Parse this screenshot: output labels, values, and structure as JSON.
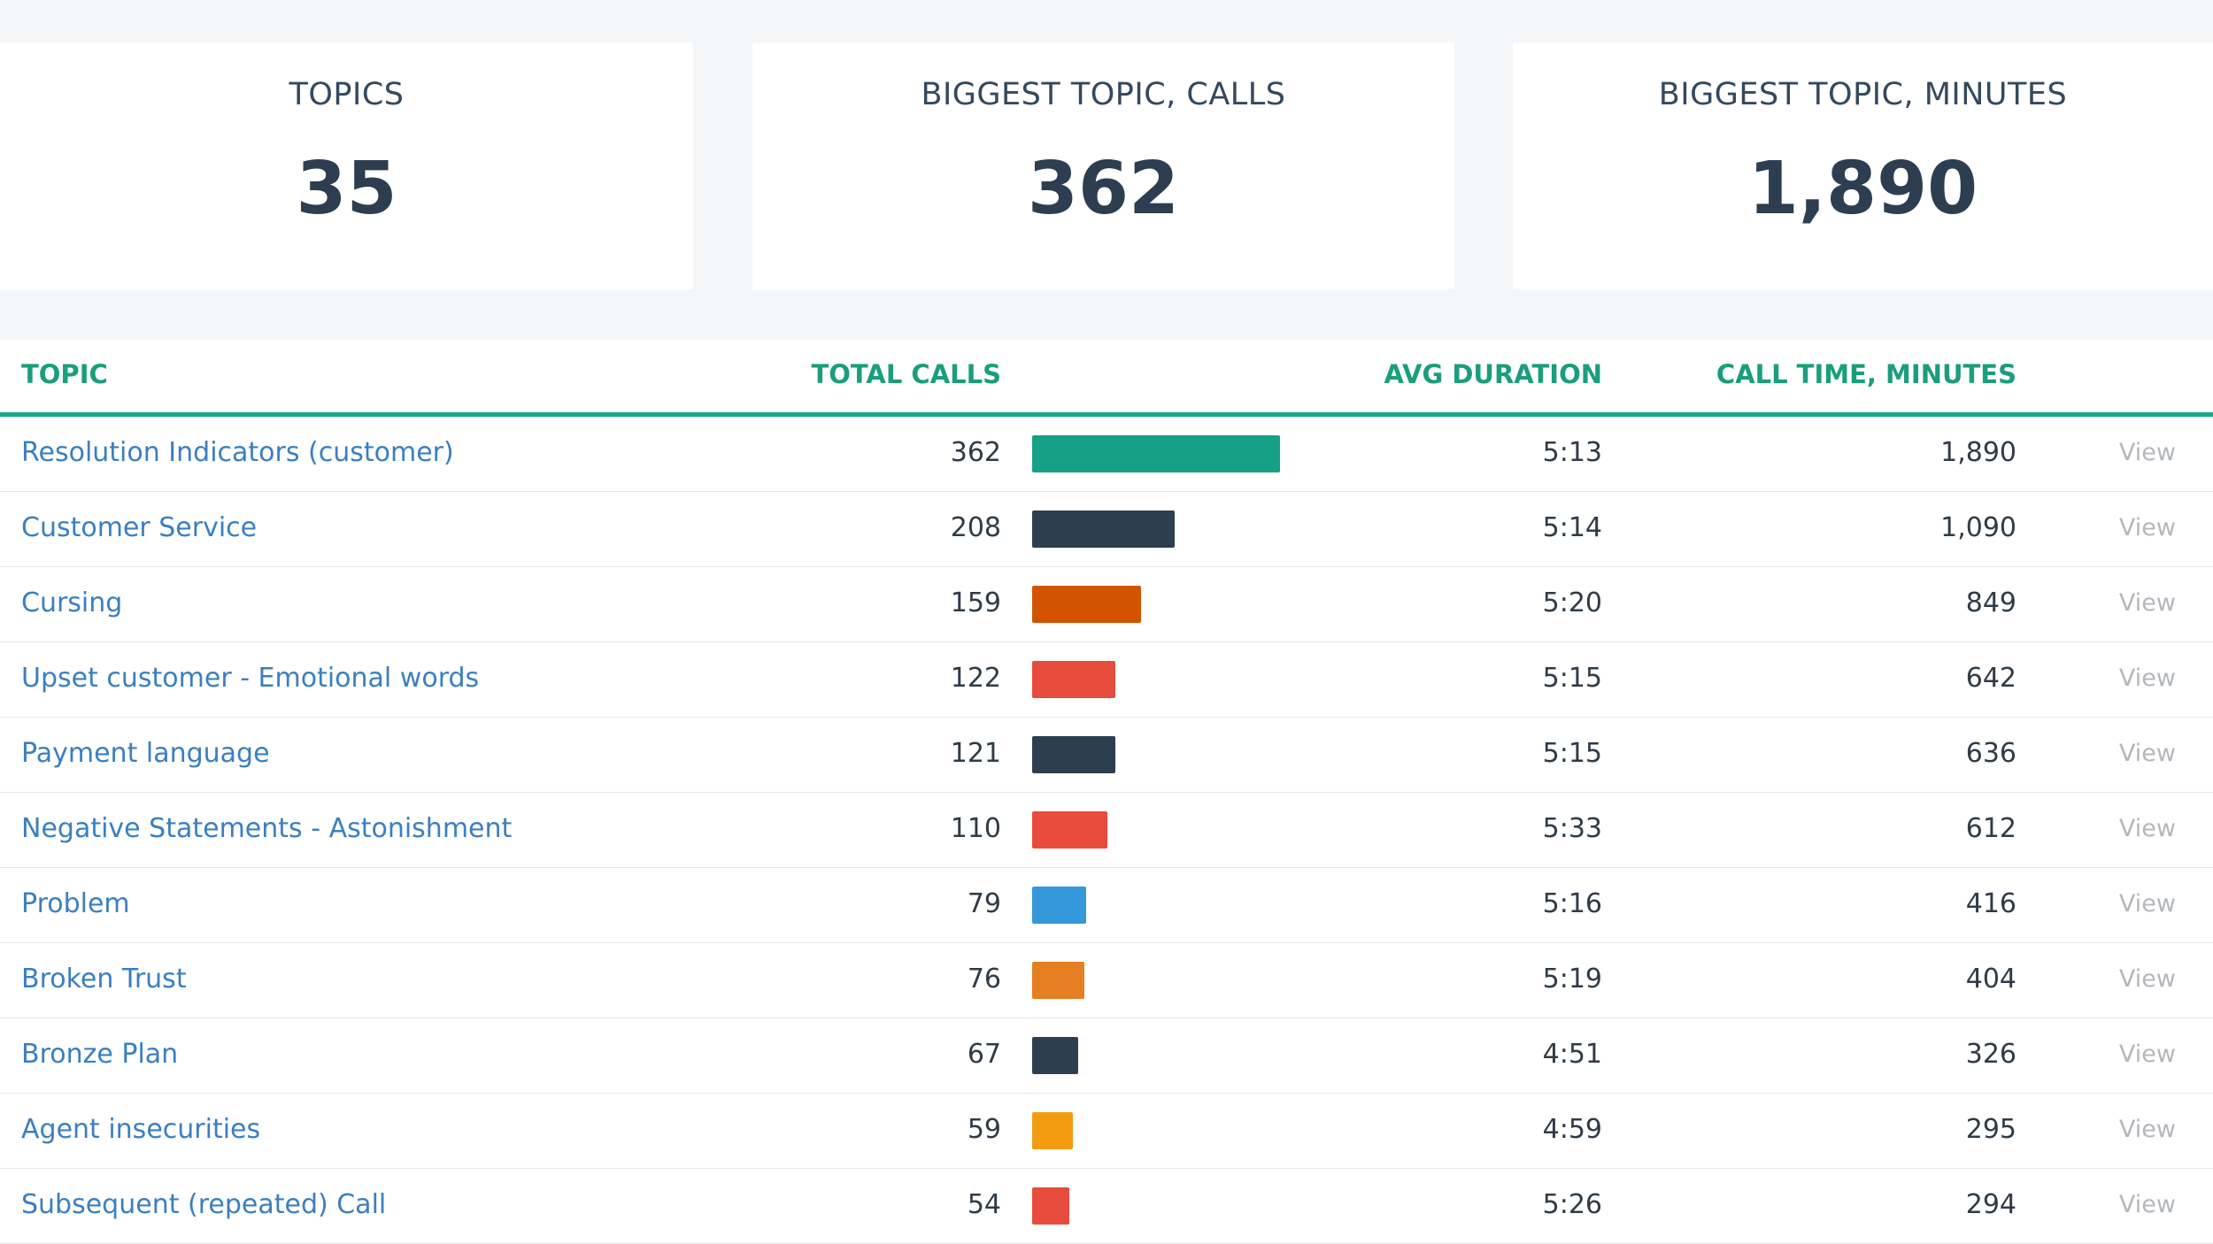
{
  "summary": {
    "topics_label": "TOPICS",
    "topics_value": "35",
    "biggest_calls_label": "BIGGEST TOPIC, CALLS",
    "biggest_calls_value": "362",
    "biggest_minutes_label": "BIGGEST TOPIC, MINUTES",
    "biggest_minutes_value": "1,890"
  },
  "table": {
    "headers": {
      "topic": "TOPIC",
      "total_calls": "TOTAL CALLS",
      "avg_duration": "AVG DURATION",
      "call_time": "CALL TIME, MINUTES"
    },
    "max_calls": 362,
    "rows": [
      {
        "topic": "Resolution Indicators (customer)",
        "calls": "362",
        "calls_num": 362,
        "bar_color": "#16a085",
        "duration": "5:13",
        "minutes": "1,890",
        "action": "View"
      },
      {
        "topic": "Customer Service",
        "calls": "208",
        "calls_num": 208,
        "bar_color": "#2c3e50",
        "duration": "5:14",
        "minutes": "1,090",
        "action": "View"
      },
      {
        "topic": "Cursing",
        "calls": "159",
        "calls_num": 159,
        "bar_color": "#d35400",
        "duration": "5:20",
        "minutes": "849",
        "action": "View"
      },
      {
        "topic": "Upset customer - Emotional words",
        "calls": "122",
        "calls_num": 122,
        "bar_color": "#e74c3c",
        "duration": "5:15",
        "minutes": "642",
        "action": "View"
      },
      {
        "topic": "Payment language",
        "calls": "121",
        "calls_num": 121,
        "bar_color": "#2c3e50",
        "duration": "5:15",
        "minutes": "636",
        "action": "View"
      },
      {
        "topic": "Negative Statements - Astonishment",
        "calls": "110",
        "calls_num": 110,
        "bar_color": "#e74c3c",
        "duration": "5:33",
        "minutes": "612",
        "action": "View"
      },
      {
        "topic": "Problem",
        "calls": "79",
        "calls_num": 79,
        "bar_color": "#3498db",
        "duration": "5:16",
        "minutes": "416",
        "action": "View"
      },
      {
        "topic": "Broken Trust",
        "calls": "76",
        "calls_num": 76,
        "bar_color": "#e67e22",
        "duration": "5:19",
        "minutes": "404",
        "action": "View"
      },
      {
        "topic": "Bronze Plan",
        "calls": "67",
        "calls_num": 67,
        "bar_color": "#2c3e50",
        "duration": "4:51",
        "minutes": "326",
        "action": "View"
      },
      {
        "topic": "Agent insecurities",
        "calls": "59",
        "calls_num": 59,
        "bar_color": "#f39c12",
        "duration": "4:59",
        "minutes": "295",
        "action": "View"
      },
      {
        "topic": "Subsequent (repeated) Call",
        "calls": "54",
        "calls_num": 54,
        "bar_color": "#e74c3c",
        "duration": "5:26",
        "minutes": "294",
        "action": "View"
      }
    ]
  }
}
